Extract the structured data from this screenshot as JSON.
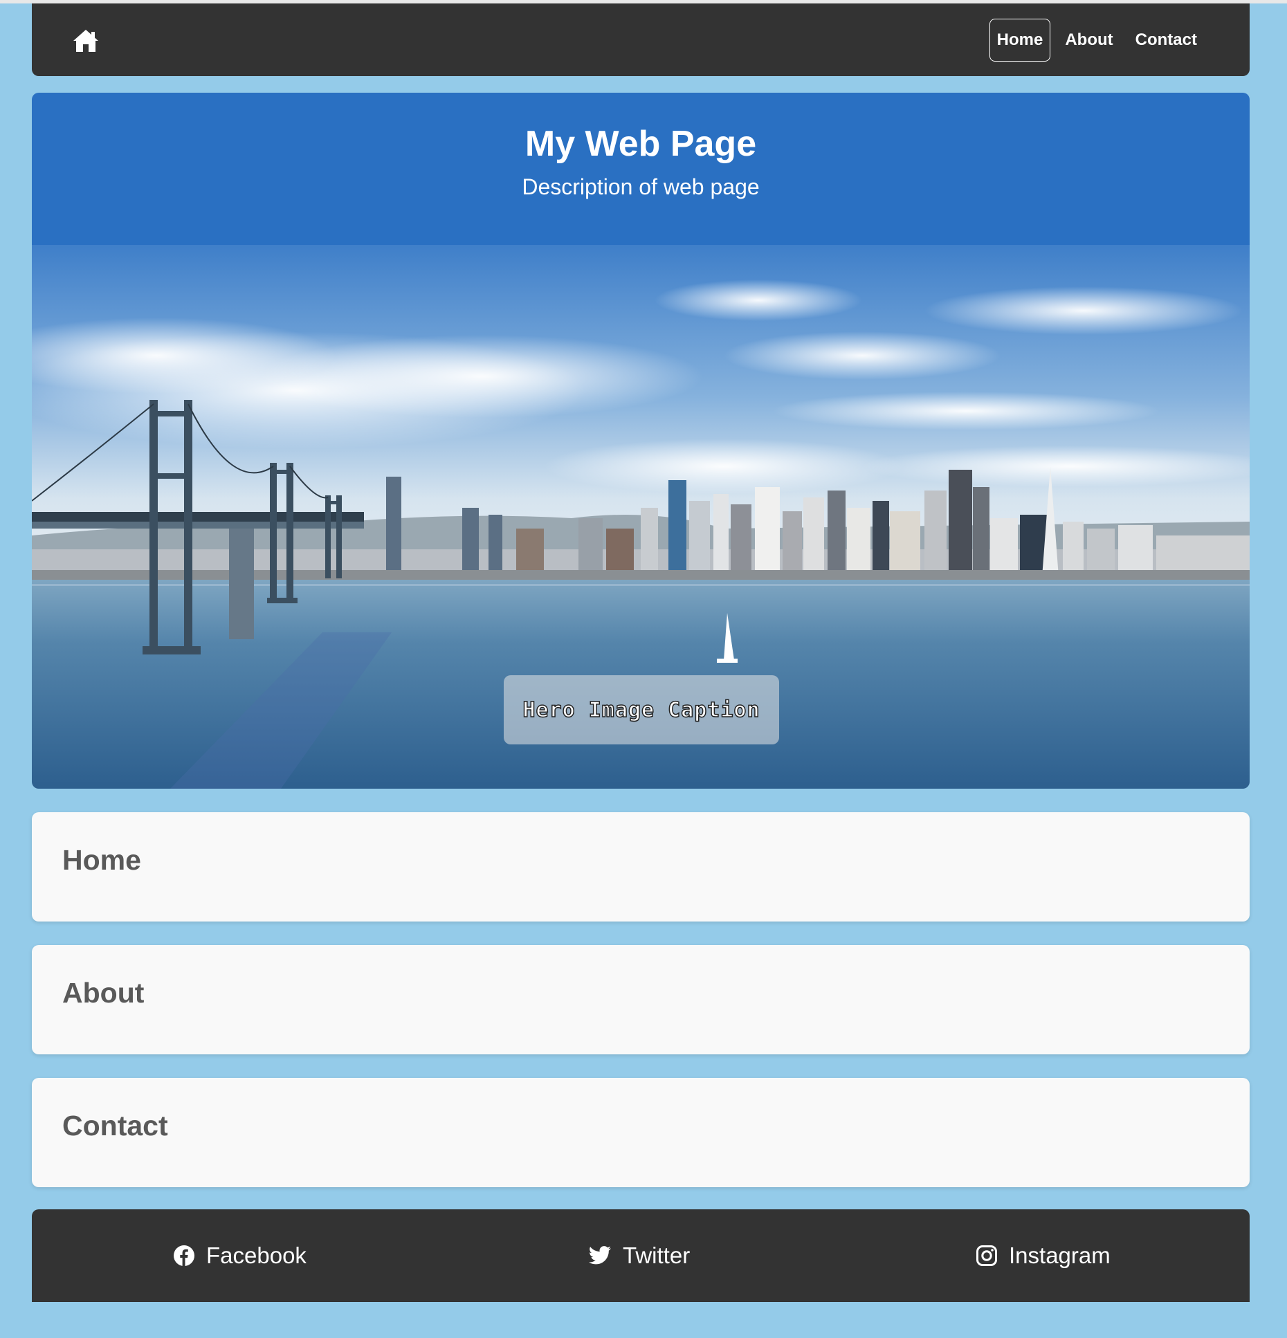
{
  "nav": {
    "home_icon": "home-icon",
    "links": [
      {
        "label": "Home",
        "active": true
      },
      {
        "label": "About",
        "active": false
      },
      {
        "label": "Contact",
        "active": false
      }
    ]
  },
  "header": {
    "title": "My Web Page",
    "description": "Description of web page"
  },
  "hero": {
    "caption": "Hero Image Caption"
  },
  "sections": [
    {
      "heading": "Home"
    },
    {
      "heading": "About"
    },
    {
      "heading": "Contact"
    }
  ],
  "footer": {
    "links": [
      {
        "label": "Facebook",
        "icon": "facebook-icon"
      },
      {
        "label": "Twitter",
        "icon": "twitter-icon"
      },
      {
        "label": "Instagram",
        "icon": "instagram-icon"
      }
    ]
  },
  "colors": {
    "page_background": "#94cbe9",
    "navbar": "#333333",
    "header": "#2a70c2",
    "section_card": "#f9f9f9",
    "section_heading": "#595959"
  }
}
